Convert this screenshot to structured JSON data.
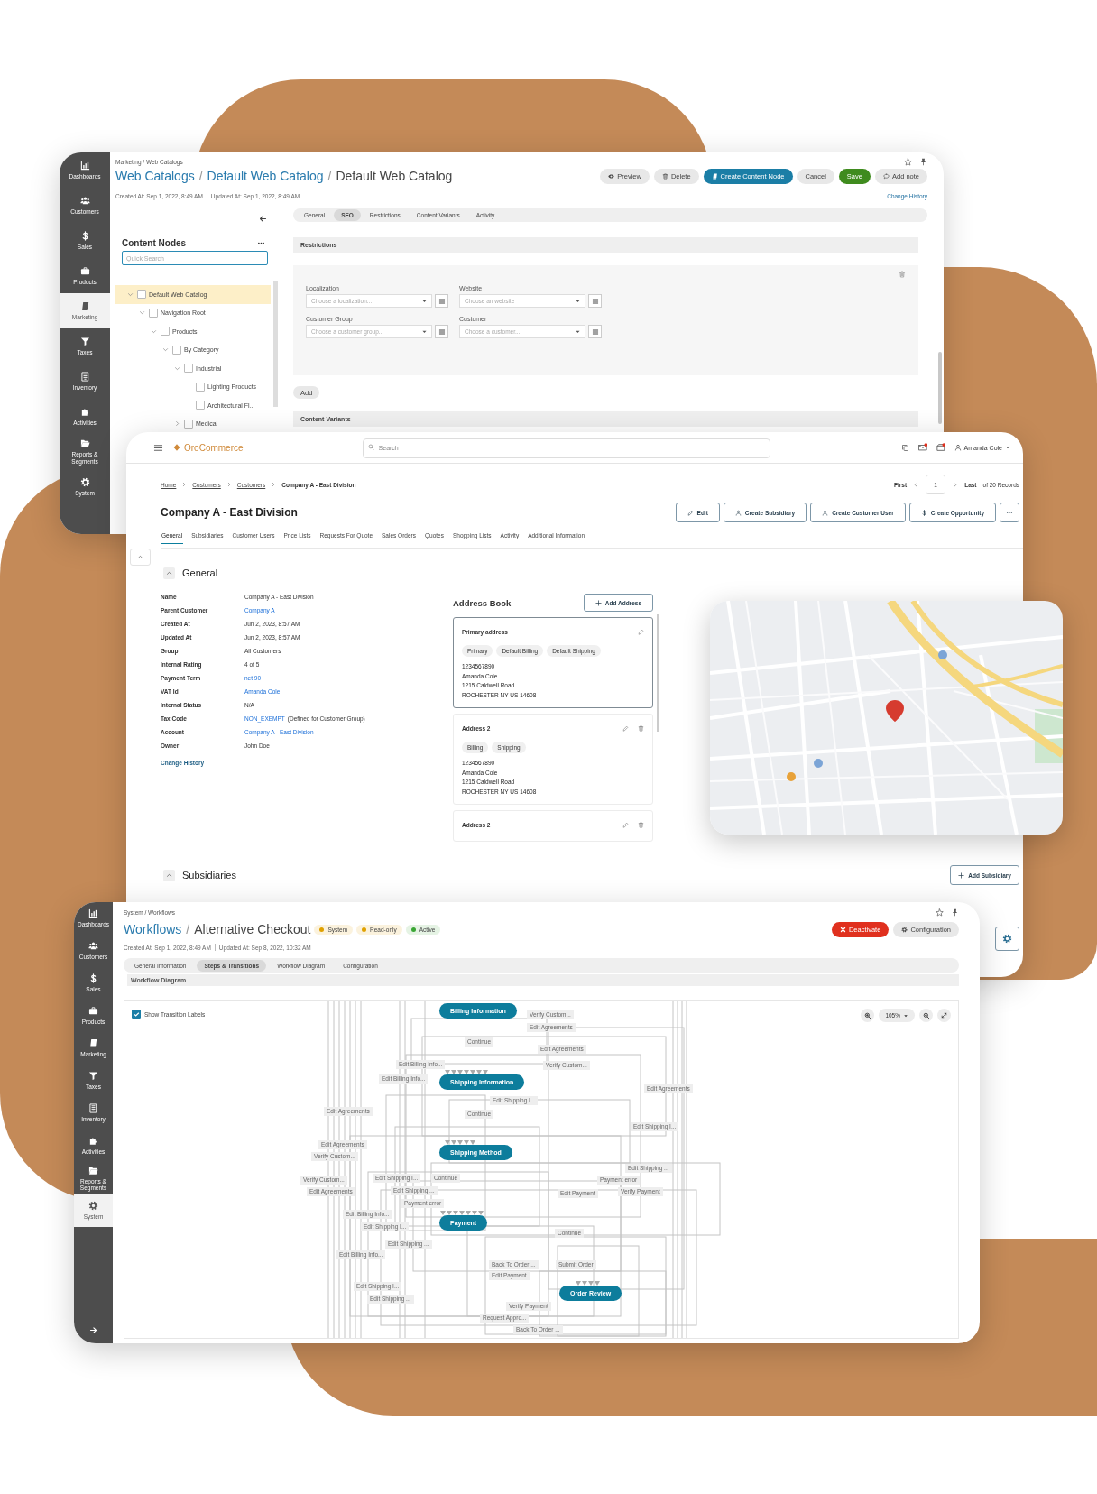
{
  "catalog_window": {
    "sidebar": [
      {
        "label": "Dashboards",
        "selected": false
      },
      {
        "label": "Customers",
        "selected": false
      },
      {
        "label": "Sales",
        "selected": false
      },
      {
        "label": "Products",
        "selected": false
      },
      {
        "label": "Marketing",
        "selected": true
      },
      {
        "label": "Taxes",
        "selected": false
      },
      {
        "label": "Inventory",
        "selected": false
      },
      {
        "label": "Activities",
        "selected": false
      },
      {
        "label": "Reports & Segments",
        "selected": false
      },
      {
        "label": "System",
        "selected": false
      }
    ],
    "breadcrumb": "Marketing / Web Catalogs",
    "title": {
      "links": [
        "Web Catalogs",
        "Default Web Catalog"
      ],
      "separator": "/",
      "current": "Default Web Catalog"
    },
    "created": "Created At: Sep 1, 2022, 8:49 AM",
    "updated": "Updated At: Sep 1, 2022, 8:49 AM",
    "actions": [
      {
        "label": "Preview",
        "kind": "plain"
      },
      {
        "label": "Delete",
        "kind": "plain"
      },
      {
        "label": "Create Content Node",
        "kind": "primary"
      },
      {
        "label": "Cancel",
        "kind": "plain"
      },
      {
        "label": "Save",
        "kind": "success"
      },
      {
        "label": "Add note",
        "kind": "plain"
      }
    ],
    "change_history": "Change History",
    "content_nodes": {
      "title": "Content Nodes",
      "search": {
        "placeholder": "Quick Search"
      },
      "tree": [
        {
          "label": "Default Web Catalog",
          "selected": true,
          "checked": false,
          "expanded": true,
          "children": [
            {
              "label": "Navigation Root",
              "selected": false,
              "checked": false,
              "expanded": true,
              "children": [
                {
                  "label": "Products",
                  "selected": false,
                  "checked": false,
                  "expanded": true,
                  "children": [
                    {
                      "label": "By Category",
                      "selected": false,
                      "checked": false,
                      "expanded": true,
                      "children": [
                        {
                          "label": "Industrial",
                          "selected": false,
                          "checked": false,
                          "expanded": true,
                          "children": [
                            {
                              "label": "Lighting Products",
                              "selected": false,
                              "checked": false
                            },
                            {
                              "label": "Architectural Fl...",
                              "selected": false,
                              "checked": false
                            }
                          ]
                        },
                        {
                          "label": "Medical",
                          "selected": false,
                          "checked": false,
                          "expanded": false
                        }
                      ]
                    }
                  ]
                }
              ]
            }
          ]
        }
      ]
    },
    "tabs": [
      {
        "label": "General",
        "selected": false
      },
      {
        "label": "SEO",
        "selected": true
      },
      {
        "label": "Restrictions",
        "selected": false
      },
      {
        "label": "Content Variants",
        "selected": false
      },
      {
        "label": "Activity",
        "selected": false
      }
    ],
    "restrictions": {
      "title": "Restrictions",
      "fields": [
        {
          "label": "Localization",
          "placeholder": "Choose a localization..."
        },
        {
          "label": "Website",
          "placeholder": "Choose an website"
        },
        {
          "label": "Customer Group",
          "placeholder": "Choose a customer group..."
        },
        {
          "label": "Customer",
          "placeholder": "Choose a customer..."
        }
      ],
      "add_button": "Add"
    },
    "content_variants": {
      "title": "Content Variants"
    }
  },
  "customer_window": {
    "logo": "OroCommerce",
    "search": {
      "placeholder": "Search"
    },
    "user": "Amanda Cole",
    "breadcrumb": [
      {
        "label": "Home",
        "kind": "link"
      },
      {
        "label": "Customers",
        "kind": "link"
      },
      {
        "label": "Customers",
        "kind": "link"
      },
      {
        "label": "Company A - East Division",
        "kind": "current"
      }
    ],
    "pager": {
      "first": "First",
      "page": "1",
      "last": "Last",
      "total": "of 20 Records"
    },
    "title": "Company A - East Division",
    "actions": [
      "Edit",
      "Create Subsidiary",
      "Create Customer User",
      "Create Opportunity"
    ],
    "tabs": [
      {
        "label": "General",
        "selected": true
      },
      {
        "label": "Subsidiaries",
        "selected": false
      },
      {
        "label": "Customer Users",
        "selected": false
      },
      {
        "label": "Price Lists",
        "selected": false
      },
      {
        "label": "Requests For Quote",
        "selected": false
      },
      {
        "label": "Sales Orders",
        "selected": false
      },
      {
        "label": "Quotes",
        "selected": false
      },
      {
        "label": "Shopping Lists",
        "selected": false
      },
      {
        "label": "Activity",
        "selected": false
      },
      {
        "label": "Additional Information",
        "selected": false
      }
    ],
    "general": {
      "title": "General",
      "fields": [
        {
          "label": "Name",
          "value": "Company A - East Division",
          "kind": "text"
        },
        {
          "label": "Parent Customer",
          "value": "Company A",
          "kind": "link"
        },
        {
          "label": "Created At",
          "value": "Jun 2, 2023, 8:57 AM",
          "kind": "text"
        },
        {
          "label": "Updated At",
          "value": "Jun 2, 2023, 8:57 AM",
          "kind": "text"
        },
        {
          "label": "Group",
          "value": "All Customers",
          "kind": "text"
        },
        {
          "label": "Internal Rating",
          "value": "4 of 5",
          "kind": "text"
        },
        {
          "label": "Payment Term",
          "value": "net 90",
          "kind": "link"
        },
        {
          "label": "VAT Id",
          "value": "Amanda Cole",
          "kind": "link"
        },
        {
          "label": "Internal Status",
          "value": "N/A",
          "kind": "text"
        },
        {
          "label": "Tax Code",
          "value": "NON_EXEMPT",
          "note": "(Defined for Customer Group)",
          "kind": "link"
        },
        {
          "label": "Account",
          "value": "Company A - East Division",
          "kind": "link"
        },
        {
          "label": "Owner",
          "value": "John Doe",
          "kind": "text"
        }
      ],
      "change_history": "Change History"
    },
    "address_book": {
      "title": "Address Book",
      "add_button": "Add Address",
      "addresses": [
        {
          "title": "Primary address",
          "selected": true,
          "deletable": false,
          "tags": [
            "Primary",
            "Default Billing",
            "Default Shipping"
          ],
          "lines": [
            "1234567890",
            "Amanda Cole",
            "1215 Caldwell Road",
            "ROCHESTER NY US 14608"
          ]
        },
        {
          "title": "Address 2",
          "selected": false,
          "deletable": true,
          "tags": [
            "Billing",
            "Shipping"
          ],
          "lines": [
            "1234567890",
            "Amanda Cole",
            "1215 Caldwell Road",
            "ROCHESTER NY US 14608"
          ]
        },
        {
          "title": "Address 2",
          "selected": false,
          "deletable": true
        }
      ]
    },
    "subsidiaries": {
      "title": "Subsidiaries",
      "add_button": "Add Subsidiary"
    }
  },
  "workflow_window": {
    "sidebar": [
      {
        "label": "Dashboards",
        "selected": false
      },
      {
        "label": "Customers",
        "selected": false
      },
      {
        "label": "Sales",
        "selected": false
      },
      {
        "label": "Products",
        "selected": false
      },
      {
        "label": "Marketing",
        "selected": false
      },
      {
        "label": "Taxes",
        "selected": false
      },
      {
        "label": "Inventory",
        "selected": false
      },
      {
        "label": "Activities",
        "selected": false
      },
      {
        "label": "Reports & Segments",
        "selected": false
      },
      {
        "label": "System",
        "selected": true
      }
    ],
    "breadcrumb": "System / Workflows",
    "title": {
      "links": [
        "Workflows"
      ],
      "separator": "/",
      "current": "Alternative Checkout"
    },
    "badges": [
      {
        "label": "System",
        "color": "#e0a100"
      },
      {
        "label": "Read-only",
        "color": "#e0a100"
      },
      {
        "label": "Active",
        "color": "#3aa635"
      }
    ],
    "actions": [
      {
        "label": "Deactivate",
        "kind": "danger"
      },
      {
        "label": "Configuration",
        "kind": "plain"
      }
    ],
    "created": "Created At: Sep 1, 2022, 8:49 AM",
    "updated": "Updated At: Sep 8, 2022, 10:32 AM",
    "tabs": [
      {
        "label": "General Information",
        "selected": false
      },
      {
        "label": "Steps & Transitions",
        "selected": true
      },
      {
        "label": "Workflow Diagram",
        "selected": false
      },
      {
        "label": "Configuration",
        "selected": false
      }
    ],
    "section_title": "Workflow Diagram",
    "show_labels": {
      "label": "Show Transition Labels",
      "checked": true
    },
    "zoom": "105%",
    "diagram": {
      "steps": [
        "Billing Information",
        "Shipping Information",
        "Shipping Method",
        "Payment",
        "Order Review"
      ],
      "transitions": [
        "Verify Custom...",
        "Edit Agreements",
        "Continue",
        "Edit Agreements",
        "Edit Billing Info...",
        "Verify Custom...",
        "Edit Billing Info...",
        "Edit Agreements",
        "Edit Shipping I...",
        "Edit Agreements",
        "Continue",
        "Edit Shipping I...",
        "Edit Agreements",
        "Verify Custom...",
        "Edit Shipping ...",
        "Verify Custom...",
        "Edit Shipping I...",
        "Continue",
        "Payment error",
        "Edit Agreements",
        "Edit Shipping ...",
        "Edit Payment",
        "Verify Payment",
        "Payment error",
        "Edit Billing Info...",
        "Edit Shipping I...",
        "Continue",
        "Edit Shipping ...",
        "Edit Billing Info...",
        "Back To Order ...",
        "Submit Order",
        "Edit Payment",
        "Edit Shipping I...",
        "Edit Shipping ...",
        "Verify Payment",
        "Request Appro...",
        "Back To Order ..."
      ]
    }
  }
}
